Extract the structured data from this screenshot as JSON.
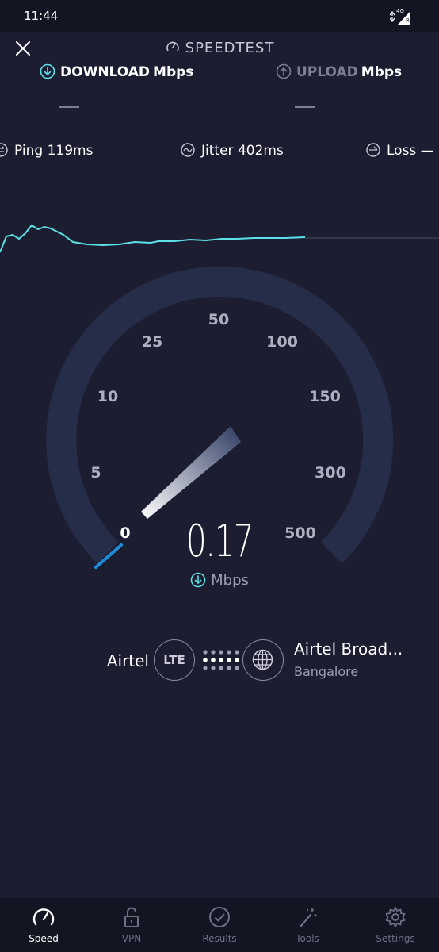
{
  "status_bar": {
    "time": "11:44",
    "network": "4G",
    "network_sub": "R"
  },
  "header": {
    "title": "SPEEDTEST"
  },
  "tabs": {
    "download": {
      "label": "DOWNLOAD",
      "unit": "Mbps",
      "value": "—"
    },
    "upload": {
      "label": "UPLOAD",
      "unit": "Mbps",
      "value": "—"
    }
  },
  "metrics": {
    "ping": {
      "label": "Ping",
      "value": "119ms"
    },
    "jitter": {
      "label": "Jitter",
      "value": "402ms"
    },
    "loss": {
      "label": "Loss",
      "value": "—"
    }
  },
  "gauge": {
    "scale_labels": [
      "0",
      "5",
      "10",
      "25",
      "50",
      "100",
      "150",
      "300",
      "500"
    ],
    "speed_value": "0.17",
    "speed_unit": "Mbps"
  },
  "connection": {
    "provider": "Airtel",
    "technology": "LTE",
    "server_name": "Airtel Broad...",
    "server_location": "Bangalore"
  },
  "nav": {
    "items": [
      {
        "label": "Speed",
        "icon": "speedometer-icon",
        "active": true
      },
      {
        "label": "VPN",
        "icon": "lock-icon",
        "active": false
      },
      {
        "label": "Results",
        "icon": "check-circle-icon",
        "active": false
      },
      {
        "label": "Tools",
        "icon": "magic-wand-icon",
        "active": false
      },
      {
        "label": "Settings",
        "icon": "gear-icon",
        "active": false
      }
    ]
  },
  "colors": {
    "background": "#1c1d31",
    "accent": "#5ce1e6",
    "gauge_track": "#2a3250",
    "gauge_active": "#1b8fd9"
  }
}
